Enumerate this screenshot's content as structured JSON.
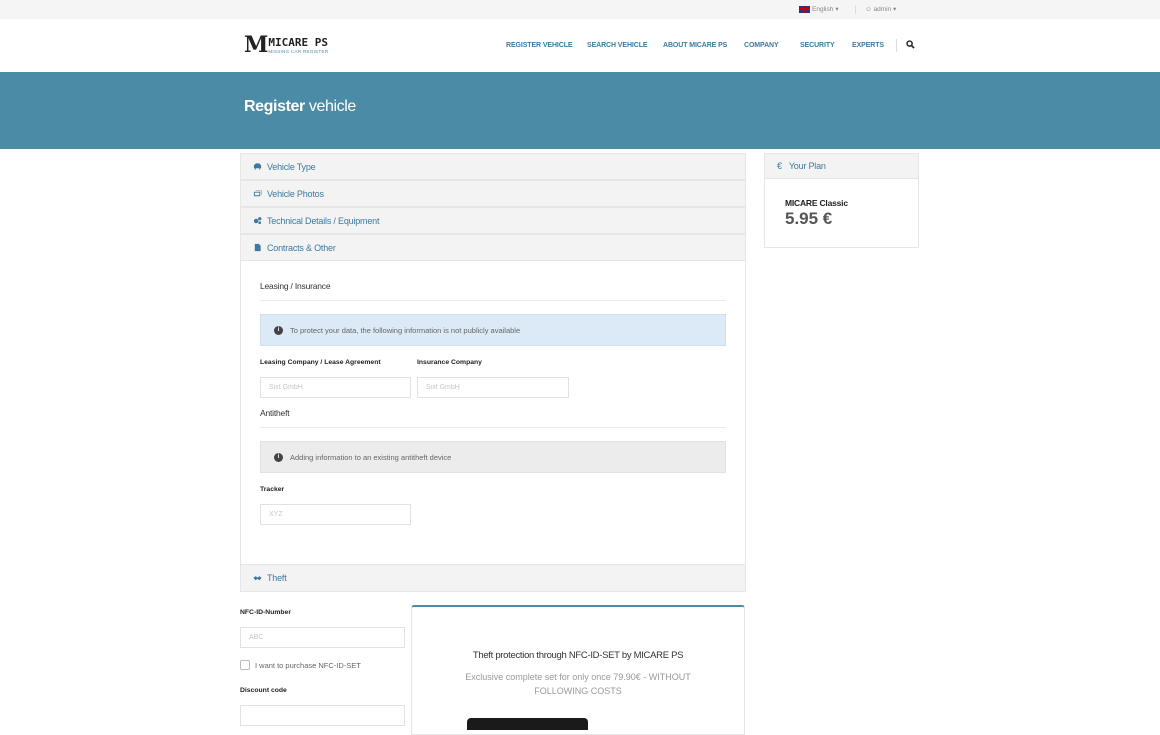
{
  "topbar": {
    "language": "English",
    "user": "admin"
  },
  "brand": {
    "mark": "M",
    "name": "MICARE PS",
    "tagline": "MISSING CAR REGISTER"
  },
  "nav": {
    "items": [
      "REGISTER VEHICLE",
      "SEARCH VEHICLE",
      "ABOUT MICARE PS",
      "COMPANY",
      "SECURITY",
      "EXPERTS"
    ]
  },
  "banner": {
    "title_bold": "Register",
    "title_rest": " vehicle"
  },
  "accordion": {
    "vehicle_type": "Vehicle Type",
    "vehicle_photos": "Vehicle Photos",
    "technical": "Technical Details / Equipment",
    "contracts": "Contracts & Other",
    "theft": "Theft"
  },
  "contracts": {
    "leasing_title": "Leasing / Insurance",
    "privacy_alert": "To protect your data, the following information is not publicly available",
    "leasing_label": "Leasing Company / Lease Agreement",
    "leasing_placeholder": "Sixt GmbH",
    "insurance_label": "Insurance Company",
    "insurance_placeholder": "Sixt GmbH",
    "antitheft_title": "Antitheft",
    "antitheft_alert": "Adding information to an existing antitheft device",
    "tracker_label": "Tracker",
    "tracker_placeholder": "XYZ"
  },
  "theft": {
    "nfc_label": "NFC-ID-Number",
    "nfc_placeholder": "ABC",
    "purchase_checkbox": "I want to purchase NFC-ID-SET",
    "discount_label": "Discount code",
    "discount_value": "",
    "promo_title": "Theft protection through NFC-ID-SET by MICARE PS",
    "promo_desc": "Exclusive complete set for only once 79.90€ - WITHOUT FOLLOWING COSTS"
  },
  "plan": {
    "heading": "Your Plan",
    "name": "MICARE Classic",
    "price": "5.95 €"
  },
  "colors": {
    "accent": "#4b8ba5",
    "link": "#3c7aa0",
    "info_bg": "#dbeaf6"
  }
}
